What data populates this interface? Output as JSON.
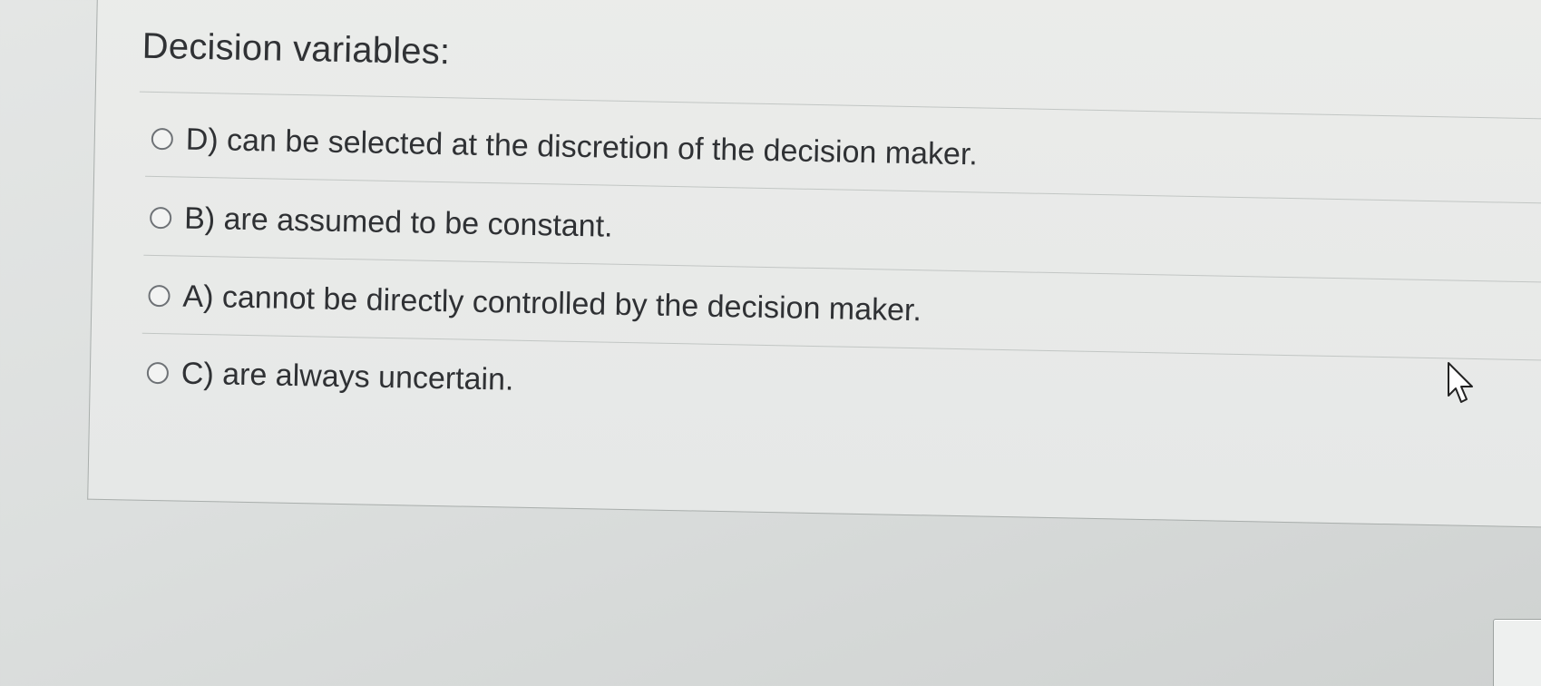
{
  "question": {
    "title": "Decision variables:"
  },
  "choices": [
    {
      "label": "D) can be selected at the discretion of the decision maker."
    },
    {
      "label": "B) are assumed to be constant."
    },
    {
      "label": "A) cannot be directly controlled by the decision maker."
    },
    {
      "label": "C) are always uncertain."
    }
  ],
  "icons": {
    "radio": "radio-unselected-icon",
    "cursor": "mouse-pointer-icon"
  },
  "colors": {
    "text": "#303235",
    "border": "#a9aeac",
    "background": "#e6e8e7"
  }
}
